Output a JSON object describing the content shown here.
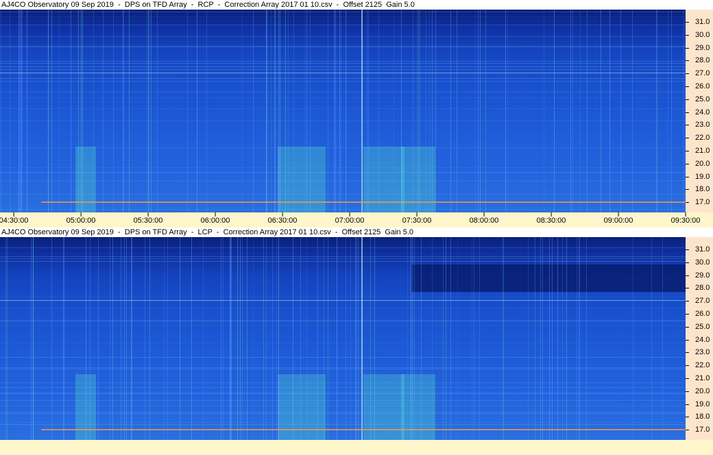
{
  "panels": [
    {
      "title": "AJ4CO Observatory 09 Sep 2019  -  DPS on TFD Array  -  RCP  -  Correction Array 2017 01 10.csv  -  Offset 2125  Gain 5.0",
      "polarization": "RCP"
    },
    {
      "title": "AJ4CO Observatory 09 Sep 2019  -  DPS on TFD Array  -  LCP  -  Correction Array 2017 01 10.csv  -  Offset 2125  Gain 5.0",
      "polarization": "LCP"
    }
  ],
  "y_axis": {
    "ticks": [
      "31.0",
      "30.0",
      "29.0",
      "28.0",
      "27.0",
      "26.0",
      "25.0",
      "24.0",
      "23.0",
      "22.0",
      "21.0",
      "20.0",
      "19.0",
      "18.0",
      "17.0"
    ]
  },
  "x_axis": {
    "ticks": [
      "04:30:00",
      "05:00:00",
      "05:30:00",
      "06:00:00",
      "06:30:00",
      "07:00:00",
      "07:30:00",
      "08:00:00",
      "08:30:00",
      "09:00:00",
      "09:30:00"
    ]
  },
  "colors": {
    "plot_dark": "#0a1f7a",
    "plot_mid": "#1a52cf",
    "plot_light": "#2a6ee0",
    "y_axis_bg": "#fde5cc",
    "x_axis_bg": "#fff6cc",
    "streak": "#7fd8ff",
    "burst": "#5cf0c8",
    "band": "#ff9a40"
  }
}
